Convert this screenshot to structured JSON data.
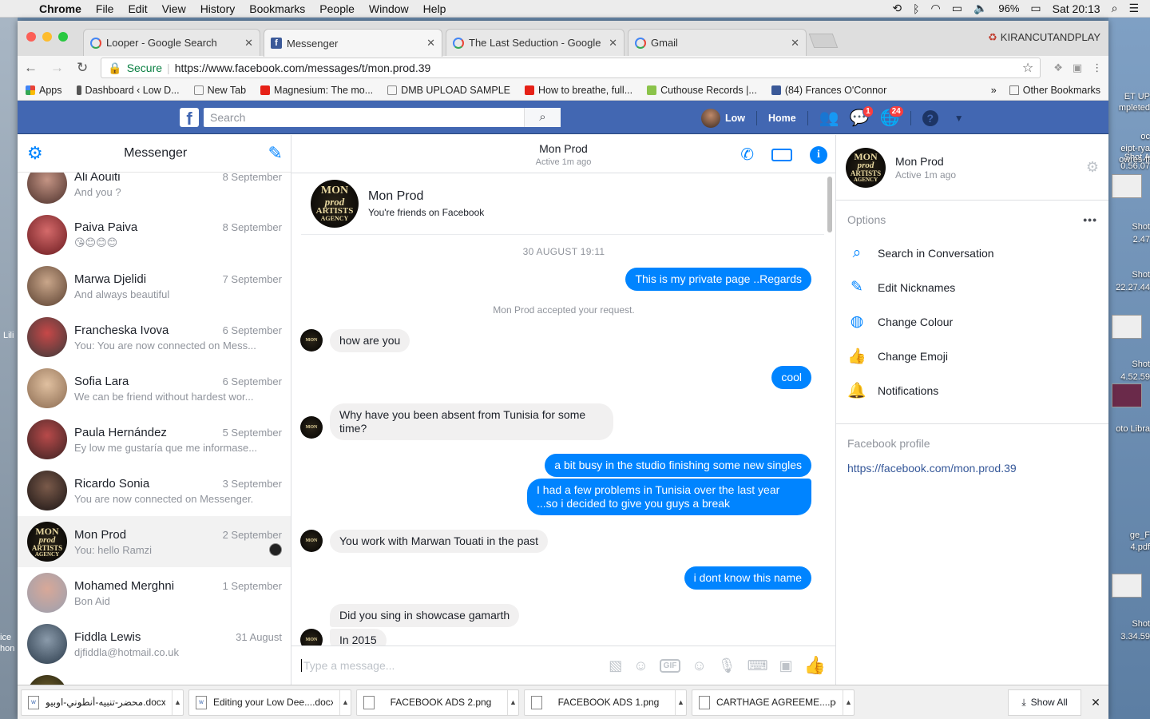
{
  "menubar": {
    "app": "Chrome",
    "items": [
      "File",
      "Edit",
      "View",
      "History",
      "Bookmarks",
      "People",
      "Window",
      "Help"
    ],
    "battery": "96%",
    "clock": "Sat 20:13"
  },
  "tabs": [
    {
      "title": "Looper - Google Search",
      "icon": "google"
    },
    {
      "title": "Messenger",
      "icon": "facebook"
    },
    {
      "title": "The Last Seduction - Google S",
      "icon": "google"
    },
    {
      "title": "Gmail",
      "icon": "google"
    }
  ],
  "profile_name": "KIRANCUTANDPLAY",
  "address": {
    "secure_label": "Secure",
    "url": "https://www.facebook.com/messages/t/mon.prod.39"
  },
  "bookmarks": [
    "Apps",
    "Dashboard ‹ Low D...",
    "New Tab",
    "Magnesium: The mo...",
    "DMB UPLOAD SAMPLE",
    "How to breathe, full...",
    "Cuthouse Records |...",
    "(84) Frances O'Connor"
  ],
  "other_bookmarks": "Other Bookmarks",
  "fb": {
    "search_placeholder": "Search",
    "user_name": "Low",
    "home": "Home",
    "messages_badge": "1",
    "notifications_badge": "24",
    "accent": "#4267b2"
  },
  "messenger": {
    "title": "Messenger",
    "conversations": [
      {
        "name": "Ali Aouiti",
        "date": "8 September",
        "snippet": "And you ?"
      },
      {
        "name": "Paiva Paiva",
        "date": "8 September",
        "snippet": "😘😊😊😊"
      },
      {
        "name": "Marwa Djelidi",
        "date": "7 September",
        "snippet": "And always beautiful"
      },
      {
        "name": "Francheska Ivova",
        "date": "6 September",
        "snippet": "You: You are now connected on Mess..."
      },
      {
        "name": "Sofia Lara",
        "date": "6 September",
        "snippet": "We can be friend without hardest wor..."
      },
      {
        "name": "Paula Hernández",
        "date": "5 September",
        "snippet": "Ey low me gustaría que me informase..."
      },
      {
        "name": "Ricardo Sonia",
        "date": "3 September",
        "snippet": "You are now connected on Messenger."
      },
      {
        "name": "Mon Prod",
        "date": "2 September",
        "snippet": "You: hello Ramzi"
      },
      {
        "name": "Mohamed Merghni",
        "date": "1 September",
        "snippet": "Bon Aid"
      },
      {
        "name": "Fiddla Lewis",
        "date": "31 August",
        "snippet": "djfiddla@hotmail.co.uk"
      }
    ]
  },
  "chat": {
    "name": "Mon Prod",
    "active": "Active 1m ago",
    "intro_name": "Mon Prod",
    "intro_sub": "You're friends on Facebook",
    "timestamp": "30 AUGUST 19:11",
    "system_msg": "Mon Prod accepted your request.",
    "messages": [
      {
        "dir": "out",
        "text": "This is my private page ..Regards"
      },
      {
        "dir": "in",
        "text": "how are you"
      },
      {
        "dir": "out",
        "text": "cool"
      },
      {
        "dir": "in",
        "text": "Why have you been absent from Tunisia for some time?"
      },
      {
        "dir": "out",
        "text": "a bit busy in the studio finishing some new singles"
      },
      {
        "dir": "out",
        "text": "I had a few problems in Tunisia over the last year ...so i decided to give you guys a break"
      },
      {
        "dir": "in",
        "text": "You work with Marwan Touati in the past"
      },
      {
        "dir": "out",
        "text": "i dont know this name"
      },
      {
        "dir": "in",
        "text": "Did you sing in showcase gamarth"
      },
      {
        "dir": "in",
        "text": "In 2015"
      }
    ],
    "composer_placeholder": "Type a message...",
    "bubble_color": "#0084ff"
  },
  "details": {
    "name": "Mon Prod",
    "active": "Active 1m ago",
    "options_label": "Options",
    "options": [
      "Search in Conversation",
      "Edit Nicknames",
      "Change Colour",
      "Change Emoji",
      "Notifications"
    ],
    "profile_label": "Facebook profile",
    "profile_link": "https://facebook.com/mon.prod.39"
  },
  "avatar_logo": {
    "line1": "MON",
    "line2": "prod",
    "line3": "ARTISTS",
    "line4": "AGENCY"
  },
  "downloads": [
    "محضر-تنبيه-أنطوني-اوبيو.docx",
    "Editing your Low Dee....docx",
    "FACEBOOK ADS 2.png",
    "FACEBOOK ADS 1.png",
    "CARTHAGE AGREEME....pdf"
  ],
  "show_all": "Show All",
  "desktop_labels": [
    "ET UP",
    "mpleted",
    "oc",
    "eipt-rya",
    "Shot A",
    "owres-ff",
    "0.56.07",
    "Shot",
    "2.47",
    "Shot",
    "22.27.44",
    "Lili",
    "Shot",
    "4.52.59",
    "oto Libra",
    "ge_F",
    "4.pdf",
    "ice",
    "hon",
    "Shot",
    "3.34.59"
  ]
}
